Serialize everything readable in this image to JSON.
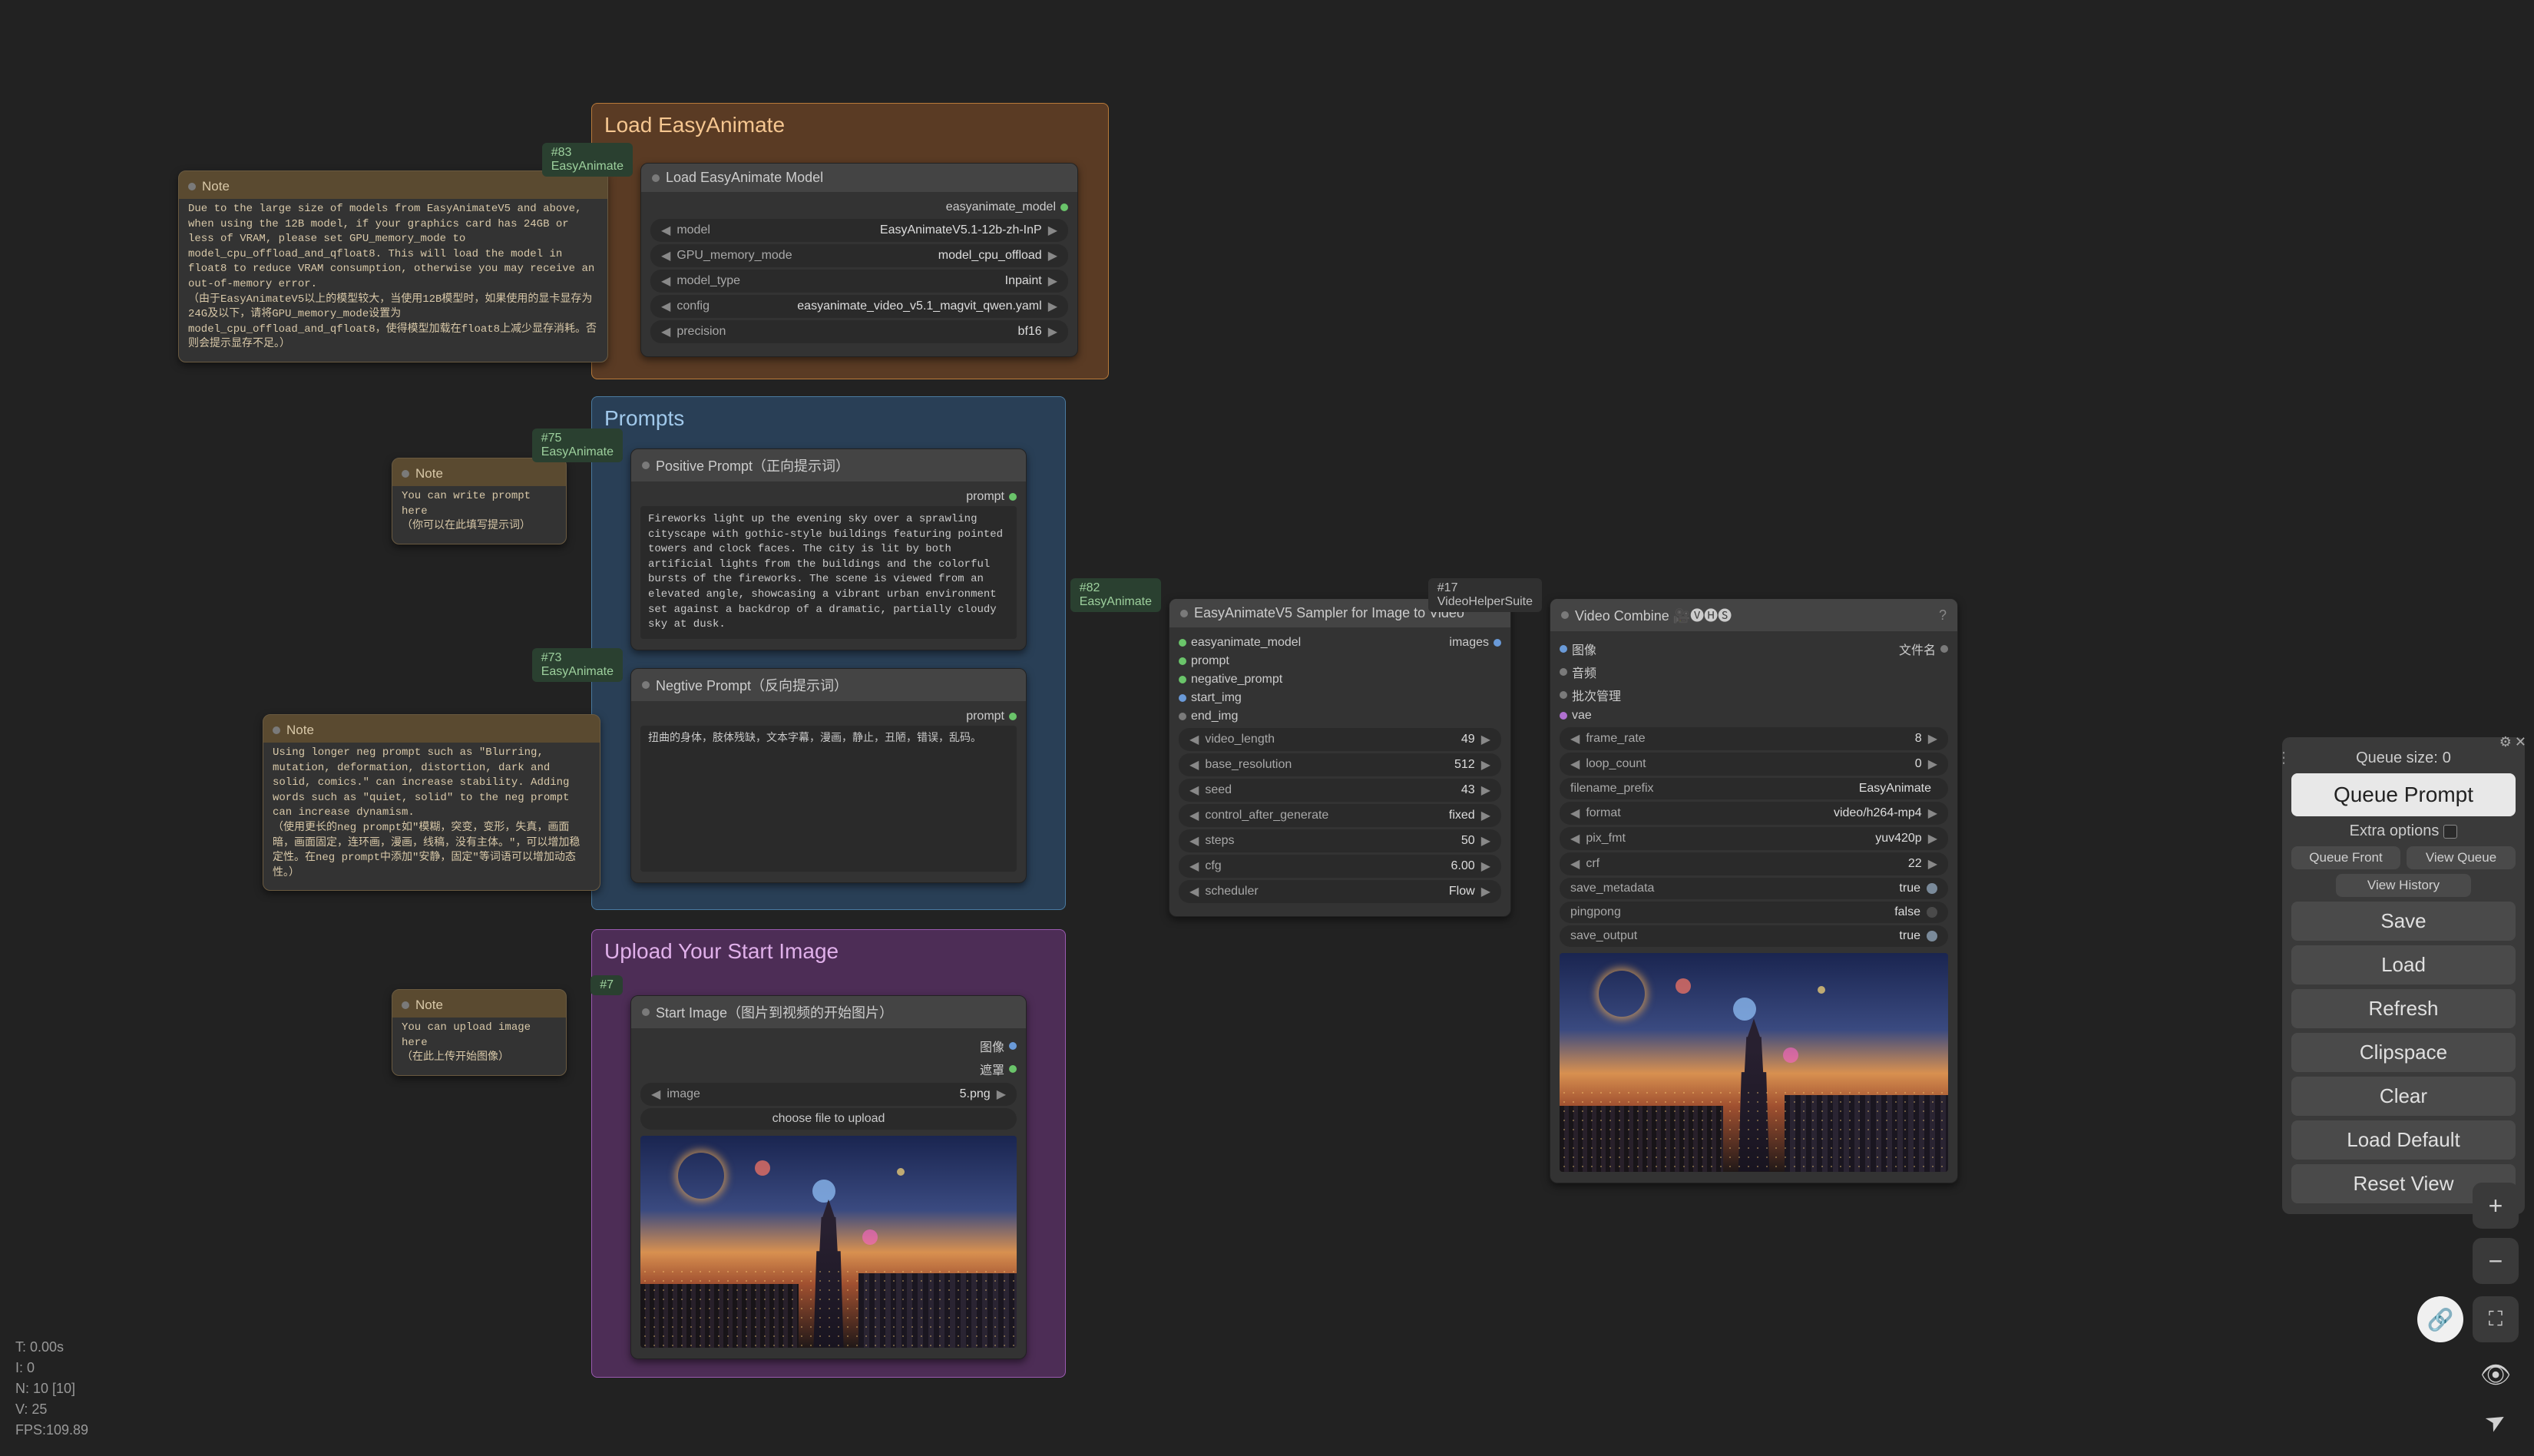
{
  "groups": {
    "load": {
      "title": "Load EasyAnimate"
    },
    "prompts": {
      "title": "Prompts"
    },
    "upload": {
      "title": "Upload Your Start Image"
    }
  },
  "notes": {
    "note1": {
      "title": "Note",
      "text": "Due to the large size of models from EasyAnimateV5 and above, when using the 12B model, if your graphics card has 24GB or less of VRAM, please set GPU_memory_mode to model_cpu_offload_and_qfloat8. This will load the model in float8 to reduce VRAM consumption, otherwise you may receive an out-of-memory error.\n（由于EasyAnimateV5以上的模型较大，当使用12B模型时，如果使用的显卡显存为24G及以下，请将GPU_memory_mode设置为model_cpu_offload_and_qfloat8，使得模型加载在float8上减少显存消耗。否则会提示显存不足。）"
    },
    "note2": {
      "title": "Note",
      "text": "You can write prompt here\n（你可以在此填写提示词）"
    },
    "note3": {
      "title": "Note",
      "text": "Using longer neg prompt such as \"Blurring, mutation, deformation, distortion, dark and solid, comics.\" can increase stability. Adding words such as \"quiet, solid\" to the neg prompt can increase dynamism.\n（使用更长的neg prompt如\"模糊，突变，变形，失真，画面暗，画面固定，连环画，漫画，线稿，没有主体。\"，可以增加稳定性。在neg prompt中添加\"安静，固定\"等词语可以增加动态性。）"
    },
    "note4": {
      "title": "Note",
      "text": "You can upload image here\n（在此上传开始图像）"
    }
  },
  "load_model": {
    "tag": "#83 EasyAnimate",
    "title": "Load EasyAnimate Model",
    "output": "easyanimate_model",
    "params": {
      "model": {
        "label": "model",
        "value": "EasyAnimateV5.1-12b-zh-InP"
      },
      "gpu": {
        "label": "GPU_memory_mode",
        "value": "model_cpu_offload"
      },
      "model_type": {
        "label": "model_type",
        "value": "Inpaint"
      },
      "config": {
        "label": "config",
        "value": "easyanimate_video_v5.1_magvit_qwen.yaml"
      },
      "precision": {
        "label": "precision",
        "value": "bf16"
      }
    }
  },
  "pos_prompt": {
    "tag": "#75 EasyAnimate",
    "title": "Positive Prompt（正向提示词）",
    "output": "prompt",
    "text": "Fireworks light up the evening sky over a sprawling cityscape with gothic-style buildings featuring pointed towers and clock faces. The city is lit by both artificial lights from the buildings and the colorful bursts of the fireworks. The scene is viewed from an elevated angle, showcasing a vibrant urban environment set against a backdrop of a dramatic, partially cloudy sky at dusk."
  },
  "neg_prompt": {
    "tag": "#73 EasyAnimate",
    "title": "Negtive Prompt（反向提示词）",
    "output": "prompt",
    "text": "扭曲的身体，肢体残缺，文本字幕，漫画，静止，丑陋，错误，乱码。"
  },
  "start_image": {
    "tag": "#7",
    "title": "Start Image（图片到视频的开始图片）",
    "outputs": {
      "image": "图像",
      "mask": "遮罩"
    },
    "param": {
      "label": "image",
      "value": "5.png"
    },
    "upload_label": "choose file to upload"
  },
  "sampler": {
    "tag": "#82 EasyAnimate",
    "title": "EasyAnimateV5 Sampler for Image to Video",
    "inputs": [
      "easyanimate_model",
      "prompt",
      "negative_prompt",
      "start_img",
      "end_img"
    ],
    "output": "images",
    "params": {
      "video_length": {
        "label": "video_length",
        "value": "49"
      },
      "base_resolution": {
        "label": "base_resolution",
        "value": "512"
      },
      "seed": {
        "label": "seed",
        "value": "43"
      },
      "control": {
        "label": "control_after_generate",
        "value": "fixed"
      },
      "steps": {
        "label": "steps",
        "value": "50"
      },
      "cfg": {
        "label": "cfg",
        "value": "6.00"
      },
      "scheduler": {
        "label": "scheduler",
        "value": "Flow"
      }
    }
  },
  "video_combine": {
    "tag": "#17 VideoHelperSuite",
    "title": "Video Combine 🎥🅥🅗🅢",
    "help_icon": "?",
    "inputs": {
      "images": "图像",
      "audio": "音频",
      "batch": "批次管理",
      "vae": "vae"
    },
    "output": "文件名",
    "params": {
      "frame_rate": {
        "label": "frame_rate",
        "value": "8"
      },
      "loop_count": {
        "label": "loop_count",
        "value": "0"
      },
      "filename_prefix": {
        "label": "filename_prefix",
        "value": "EasyAnimate"
      },
      "format": {
        "label": "format",
        "value": "video/h264-mp4"
      },
      "pix_fmt": {
        "label": "pix_fmt",
        "value": "yuv420p"
      },
      "crf": {
        "label": "crf",
        "value": "22"
      },
      "save_metadata": {
        "label": "save_metadata",
        "value": "true"
      },
      "pingpong": {
        "label": "pingpong",
        "value": "false"
      },
      "save_output": {
        "label": "save_output",
        "value": "true"
      }
    }
  },
  "panel": {
    "queue_size_label": "Queue size:",
    "queue_size_value": "0",
    "queue_prompt": "Queue Prompt",
    "extra_options": "Extra options",
    "queue_front": "Queue Front",
    "view_queue": "View Queue",
    "view_history": "View History",
    "save": "Save",
    "load": "Load",
    "refresh": "Refresh",
    "clipspace": "Clipspace",
    "clear": "Clear",
    "load_default": "Load Default",
    "reset_view": "Reset View"
  },
  "floats": {
    "plus": "+",
    "minus": "−",
    "focus": "⛶",
    "eye": "👁",
    "send": "➤",
    "link": "🔗"
  },
  "stats": {
    "t": "T: 0.00s",
    "i": "I: 0",
    "n": "N: 10 [10]",
    "v": "V: 25",
    "fps": "FPS:109.89"
  }
}
